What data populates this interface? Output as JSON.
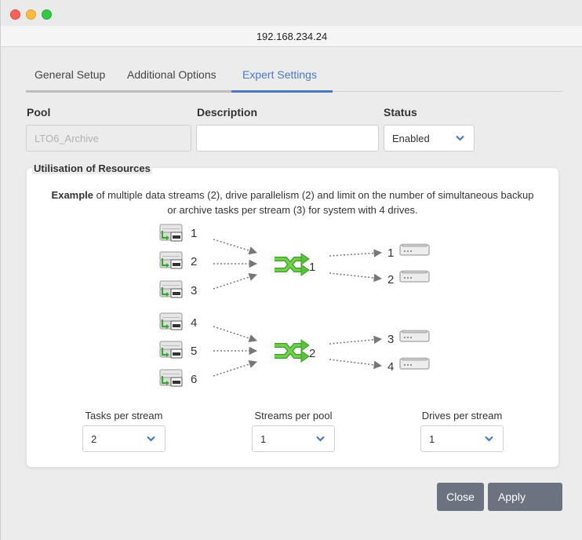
{
  "window": {
    "address": "192.168.234.24"
  },
  "tabs": [
    {
      "label": "General Setup",
      "active": false
    },
    {
      "label": "Additional Options",
      "active": false
    },
    {
      "label": "Expert Settings",
      "active": true
    }
  ],
  "form": {
    "pool_label": "Pool",
    "pool_value": "LTO6_Archive",
    "description_label": "Description",
    "description_value": "",
    "status_label": "Status",
    "status_value": "Enabled"
  },
  "resources": {
    "legend": "Utilisation of Resources",
    "example_bold": "Example",
    "example_line1": " of multiple data streams (2), drive parallelism (2) and limit on the number of simultaneous backup",
    "example_line2": "or archive tasks per stream (3) for system with 4 drives.",
    "diagram": {
      "task_numbers": [
        "1",
        "2",
        "3",
        "4",
        "5",
        "6"
      ],
      "stream_numbers": [
        "1",
        "2"
      ],
      "drive_numbers": [
        "1",
        "2",
        "3",
        "4"
      ]
    },
    "tasks_per_stream_label": "Tasks per stream",
    "tasks_per_stream_value": "2",
    "streams_per_pool_label": "Streams per pool",
    "streams_per_pool_value": "1",
    "drives_per_stream_label": "Drives per stream",
    "drives_per_stream_value": "1"
  },
  "buttons": {
    "close": "Close",
    "apply": "Apply"
  },
  "colors": {
    "accent": "#4a78c7",
    "button": "#6b7280",
    "stream_green": "#5cc03a"
  }
}
